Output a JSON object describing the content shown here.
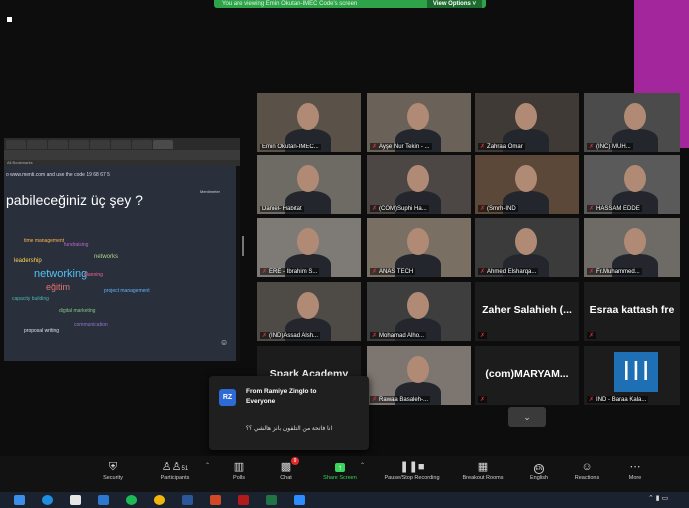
{
  "banner": {
    "text": "You are viewing Emin Okutan-IMEC Code's screen",
    "button": "View Options ˅"
  },
  "shared_screen": {
    "bookmarks": "All Bookmarks",
    "instruction": "o www.menti.com and use the code 19 68 67 5",
    "question": "pabileceğiniz üç şey ?",
    "brand": "Mentimeter",
    "wordcloud": [
      {
        "text": "networking",
        "color": "#4fc3f7"
      },
      {
        "text": "eğitim",
        "color": "#e57373"
      },
      {
        "text": "networks",
        "color": "#aed581"
      },
      {
        "text": "time management",
        "color": "#ffb74d"
      },
      {
        "text": "fundraising",
        "color": "#ba68c8"
      },
      {
        "text": "capacity building",
        "color": "#4db6ac"
      },
      {
        "text": "planning",
        "color": "#f06292"
      },
      {
        "text": "digital marketing",
        "color": "#81c784"
      },
      {
        "text": "project management",
        "color": "#64b5f6"
      },
      {
        "text": "leadership",
        "color": "#ffd54f"
      },
      {
        "text": "communication",
        "color": "#9575cd"
      },
      {
        "text": "proposal writing",
        "color": "#e0e0e0"
      }
    ]
  },
  "participants": [
    {
      "name": "Emin Okutan-IMEC...",
      "muted": false
    },
    {
      "name": "Ayşe Nur Tekin - ...",
      "muted": true
    },
    {
      "name": "Zahraa Omar",
      "muted": true
    },
    {
      "name": "(INC) MUH...",
      "muted": true
    },
    {
      "name": "Daniel- Habitat",
      "muted": false
    },
    {
      "name": "(COM)Suphi Ha...",
      "muted": true
    },
    {
      "name": "(Smrh-IND",
      "muted": true
    },
    {
      "name": "HASSAM EDDE",
      "muted": true
    },
    {
      "name": "ERE - Ibrahim S...",
      "muted": true
    },
    {
      "name": "ANAS TECH",
      "muted": true
    },
    {
      "name": "Ahmed Elsharqa...",
      "muted": true
    },
    {
      "name": "Fr.Muhammed...",
      "muted": true
    },
    {
      "name": "(IND)Assad Alsh...",
      "muted": true
    },
    {
      "name": "Mohamad Alho...",
      "muted": true
    },
    {
      "name": "Zaher  Salahieh  (...",
      "muted": true,
      "name_only": true
    },
    {
      "name": "Esraa kattash fre",
      "muted": true,
      "name_only": true
    },
    {
      "name": "Spark Academy",
      "muted": true,
      "name_only": true
    },
    {
      "name": "Rawaa Basaleh-...",
      "muted": true
    },
    {
      "name": "(com)MARYAM...",
      "muted": true,
      "name_only": true
    },
    {
      "name": "IND - Baraa Kala...",
      "muted": true
    }
  ],
  "chat": {
    "avatar": "RZ",
    "from": "From Ramiye Zinglo to",
    "to": "Everyone",
    "message": "انا فاتحة من التلفون بانز هالشي ؟؟"
  },
  "toolbar": {
    "security": "Security",
    "participants": "Participants",
    "participants_count": "51",
    "polls": "Polls",
    "chat": "Chat",
    "chat_badge": "9",
    "share": "Share Screen",
    "record": "Pause/Stop Recording",
    "breakout": "Breakout Rooms",
    "english": "English",
    "english_icon": "EN",
    "reactions": "Reactions",
    "more": "More"
  }
}
